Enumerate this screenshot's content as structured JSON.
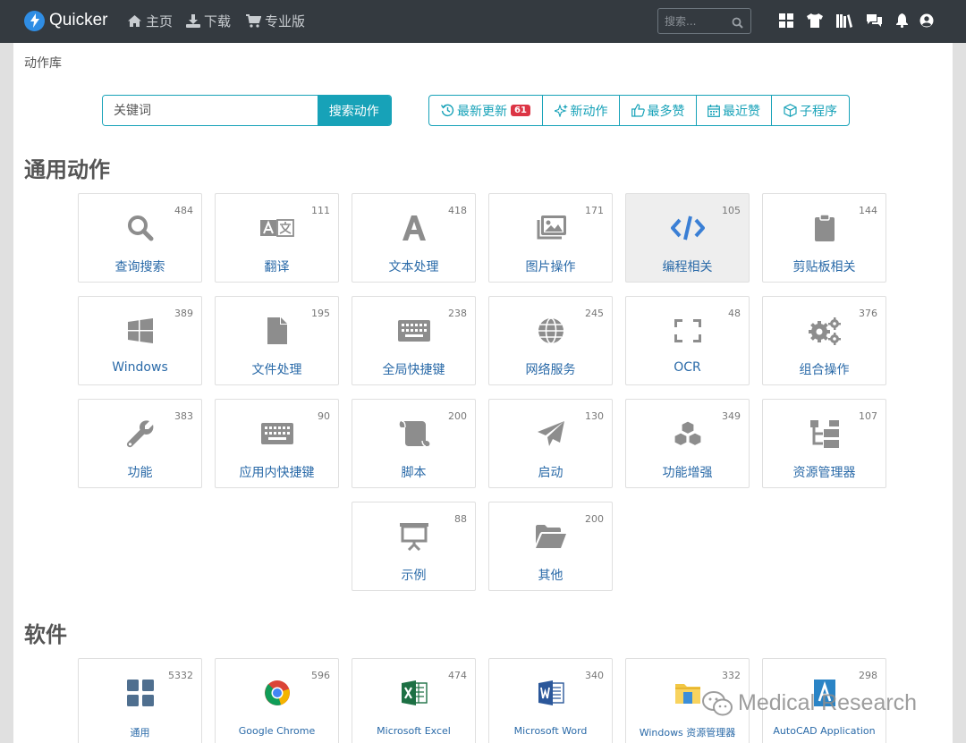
{
  "navbar": {
    "brand": "Quicker",
    "links": [
      {
        "label": "主页",
        "icon": "home-icon"
      },
      {
        "label": "下载",
        "icon": "download-icon"
      },
      {
        "label": "专业版",
        "icon": "cart-icon"
      }
    ],
    "search_placeholder": "搜索...",
    "right_icons": [
      "windows-grid-icon",
      "tshirt-icon",
      "library-icon",
      "comments-icon",
      "bell-icon",
      "user-icon"
    ]
  },
  "breadcrumb": "动作库",
  "search": {
    "placeholder": "关键词",
    "button": "搜索动作"
  },
  "filters": [
    {
      "label": "最新更新",
      "icon": "history-icon",
      "badge": "61"
    },
    {
      "label": "新动作",
      "icon": "sparkle-icon"
    },
    {
      "label": "最多赞",
      "icon": "thumbs-up-icon"
    },
    {
      "label": "最近赞",
      "icon": "calendar-icon"
    },
    {
      "label": "子程序",
      "icon": "cube-icon"
    }
  ],
  "general_section": {
    "title": "通用动作",
    "cards": [
      {
        "label": "查询搜索",
        "count": "484",
        "icon": "search-icon"
      },
      {
        "label": "翻译",
        "count": "111",
        "icon": "translate-icon"
      },
      {
        "label": "文本处理",
        "count": "418",
        "icon": "font-icon"
      },
      {
        "label": "图片操作",
        "count": "171",
        "icon": "images-icon"
      },
      {
        "label": "编程相关",
        "count": "105",
        "icon": "code-icon",
        "active": true
      },
      {
        "label": "剪贴板相关",
        "count": "144",
        "icon": "clipboard-icon"
      },
      {
        "label": "Windows",
        "count": "389",
        "icon": "windows-icon"
      },
      {
        "label": "文件处理",
        "count": "195",
        "icon": "file-icon"
      },
      {
        "label": "全局快捷键",
        "count": "238",
        "icon": "keyboard-icon"
      },
      {
        "label": "网络服务",
        "count": "245",
        "icon": "globe-icon"
      },
      {
        "label": "OCR",
        "count": "48",
        "icon": "expand-icon"
      },
      {
        "label": "组合操作",
        "count": "376",
        "icon": "cogs-icon"
      },
      {
        "label": "功能",
        "count": "383",
        "icon": "wrench-icon"
      },
      {
        "label": "应用内快捷键",
        "count": "90",
        "icon": "keyboard-icon"
      },
      {
        "label": "脚本",
        "count": "200",
        "icon": "scroll-icon"
      },
      {
        "label": "启动",
        "count": "130",
        "icon": "paper-plane-icon"
      },
      {
        "label": "功能增强",
        "count": "349",
        "icon": "cubes-icon"
      },
      {
        "label": "资源管理器",
        "count": "107",
        "icon": "sitemap-icon"
      },
      {
        "label": "示例",
        "count": "88",
        "icon": "presentation-icon"
      },
      {
        "label": "其他",
        "count": "200",
        "icon": "folder-open-icon"
      }
    ]
  },
  "software_section": {
    "title": "软件",
    "cards": [
      {
        "label": "通用",
        "count": "5332",
        "icon": "grid-icon"
      },
      {
        "label": "Google Chrome",
        "count": "596",
        "icon": "chrome-icon"
      },
      {
        "label": "Microsoft Excel",
        "count": "474",
        "icon": "excel-icon"
      },
      {
        "label": "Microsoft Word",
        "count": "340",
        "icon": "word-icon"
      },
      {
        "label": "Windows 资源管理器",
        "count": "332",
        "icon": "explorer-icon"
      },
      {
        "label": "AutoCAD Application",
        "count": "298",
        "icon": "autocad-icon"
      }
    ]
  },
  "watermark": "Medical Research",
  "colors": {
    "navbar": "#343a40",
    "accent": "#17a2b8",
    "badge": "#dc3545",
    "link": "#2a6aa8",
    "icon_gray": "#8d8d8d",
    "brand_blue": "#2f8de4"
  }
}
